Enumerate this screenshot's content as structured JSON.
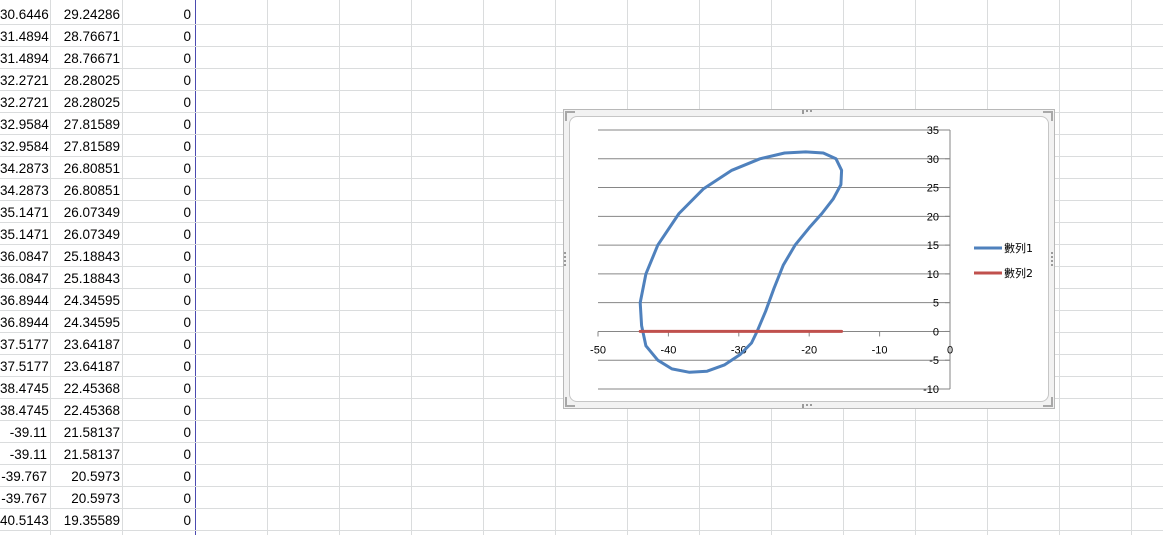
{
  "sheet": {
    "rows": [
      [
        "30.6446",
        "29.24286",
        "0"
      ],
      [
        "31.4894",
        "28.76671",
        "0"
      ],
      [
        "31.4894",
        "28.76671",
        "0"
      ],
      [
        "32.2721",
        "28.28025",
        "0"
      ],
      [
        "32.2721",
        "28.28025",
        "0"
      ],
      [
        "32.9584",
        "27.81589",
        "0"
      ],
      [
        "32.9584",
        "27.81589",
        "0"
      ],
      [
        "34.2873",
        "26.80851",
        "0"
      ],
      [
        "34.2873",
        "26.80851",
        "0"
      ],
      [
        "35.1471",
        "26.07349",
        "0"
      ],
      [
        "35.1471",
        "26.07349",
        "0"
      ],
      [
        "36.0847",
        "25.18843",
        "0"
      ],
      [
        "36.0847",
        "25.18843",
        "0"
      ],
      [
        "36.8944",
        "24.34595",
        "0"
      ],
      [
        "36.8944",
        "24.34595",
        "0"
      ],
      [
        "37.5177",
        "23.64187",
        "0"
      ],
      [
        "37.5177",
        "23.64187",
        "0"
      ],
      [
        "38.4745",
        "22.45368",
        "0"
      ],
      [
        "38.4745",
        "22.45368",
        "0"
      ],
      [
        "-39.11",
        "21.58137",
        "0"
      ],
      [
        "-39.11",
        "21.58137",
        "0"
      ],
      [
        "-39.767",
        "20.5973",
        "0"
      ],
      [
        "-39.767",
        "20.5973",
        "0"
      ],
      [
        "40.5143",
        "19.35589",
        "0"
      ]
    ]
  },
  "chart_data": {
    "type": "scatter",
    "xlim": [
      -50,
      0
    ],
    "ylim": [
      -10,
      35
    ],
    "x_ticks": [
      -50,
      -40,
      -30,
      -20,
      -10,
      0
    ],
    "y_ticks": [
      35,
      30,
      25,
      20,
      15,
      10,
      5,
      0,
      -5,
      -10
    ],
    "grid": "horizontal",
    "legend_position": "right",
    "series": [
      {
        "name": "數列1",
        "color": "#4f81bd",
        "x": [
          -27.4,
          -26.2,
          -25.0,
          -23.7,
          -22.0,
          -20.0,
          -18.2,
          -16.6,
          -15.5,
          -15.4,
          -16.2,
          -18.0,
          -20.5,
          -23.5,
          -27.0,
          -31.0,
          -35.0,
          -38.5,
          -41.5,
          -43.2,
          -44.0,
          -43.8,
          -43.2,
          -41.5,
          -39.5,
          -37.0,
          -34.5,
          -32.0,
          -29.8,
          -28.2,
          -27.4
        ],
        "y": [
          0.0,
          3.5,
          7.5,
          11.5,
          15.0,
          18.0,
          20.5,
          23.0,
          25.5,
          28.0,
          30.0,
          31.0,
          31.2,
          31.0,
          30.0,
          28.0,
          24.8,
          20.5,
          15.0,
          10.0,
          5.0,
          1.0,
          -2.5,
          -5.0,
          -6.5,
          -7.1,
          -6.9,
          -5.8,
          -4.0,
          -2.0,
          0.0
        ]
      },
      {
        "name": "數列2",
        "color": "#c0504d",
        "x": [
          -44.0,
          -15.4
        ],
        "y": [
          0,
          0
        ]
      }
    ]
  }
}
